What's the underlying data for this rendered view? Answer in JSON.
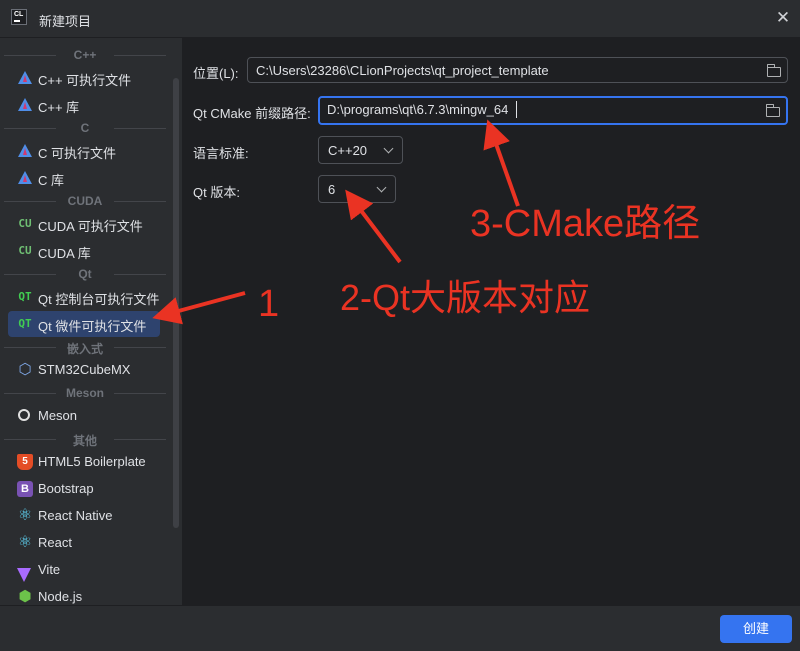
{
  "window": {
    "app_icon_text": "CL",
    "title": "新建项目"
  },
  "sidebar": {
    "sections": [
      {
        "label": "C++",
        "items": [
          {
            "icon": "clion-triangle-icon",
            "label": "C++ 可执行文件"
          },
          {
            "icon": "clion-triangle-icon",
            "label": "C++ 库"
          }
        ]
      },
      {
        "label": "C",
        "items": [
          {
            "icon": "clion-triangle-icon",
            "label": "C 可执行文件"
          },
          {
            "icon": "clion-triangle-icon",
            "label": "C 库"
          }
        ]
      },
      {
        "label": "CUDA",
        "items": [
          {
            "icon": "cuda-icon",
            "icon_text": "CU",
            "label": "CUDA 可执行文件"
          },
          {
            "icon": "cuda-icon",
            "icon_text": "CU",
            "label": "CUDA 库"
          }
        ]
      },
      {
        "label": "Qt",
        "items": [
          {
            "icon": "qt-icon",
            "icon_text": "QT",
            "label": "Qt 控制台可执行文件"
          },
          {
            "icon": "qt-icon",
            "icon_text": "QT",
            "label": "Qt 微件可执行文件",
            "selected": true
          }
        ]
      },
      {
        "label": "嵌入式",
        "items": [
          {
            "icon": "cube-icon",
            "label": "STM32CubeMX"
          }
        ]
      },
      {
        "label": "Meson",
        "items": [
          {
            "icon": "meson-icon",
            "label": "Meson"
          }
        ]
      },
      {
        "label": "其他",
        "items": [
          {
            "icon": "html5-icon",
            "icon_text": "5",
            "label": "HTML5 Boilerplate"
          },
          {
            "icon": "bootstrap-icon",
            "icon_text": "B",
            "label": "Bootstrap"
          },
          {
            "icon": "react-icon",
            "label": "React Native"
          },
          {
            "icon": "react-icon",
            "label": "React"
          },
          {
            "icon": "vite-icon",
            "label": "Vite"
          },
          {
            "icon": "nodejs-icon",
            "label": "Node.js"
          }
        ]
      }
    ]
  },
  "form": {
    "location": {
      "label": "位置(L):",
      "value": "C:\\Users\\23286\\CLionProjects\\qt_project_template"
    },
    "cmake_prefix": {
      "label": "Qt CMake 前缀路径:",
      "value": "D:\\programs\\qt\\6.7.3\\mingw_64"
    },
    "language_standard": {
      "label": "语言标准:",
      "value": "C++20"
    },
    "qt_version": {
      "label": "Qt 版本:",
      "value": "6"
    }
  },
  "footer": {
    "create_label": "创建"
  },
  "annotations": {
    "label_1": "1",
    "label_2": "2-Qt大版本对应",
    "label_3": "3-CMake路径",
    "color": "#ea3323"
  },
  "colors": {
    "accent": "#3574f0",
    "selection": "#2e436e",
    "panel": "#2b2d30",
    "content": "#1e1f22"
  }
}
